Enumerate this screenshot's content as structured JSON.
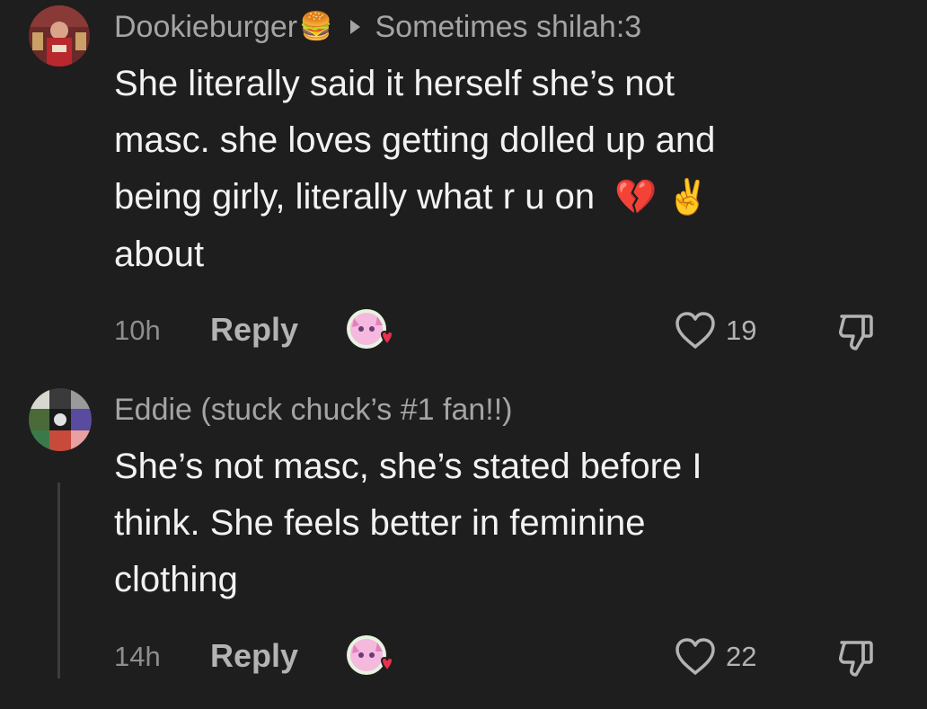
{
  "comment1": {
    "author": "Dookieburger",
    "author_emoji": "🍔",
    "replying_to": "Sometimes shilah:3",
    "text_lines": [
      "She literally said it herself she’s not",
      "masc. she loves getting dolled up and",
      "being girly, literally what r u on",
      "about"
    ],
    "line3_emojis": "💔 ✌️",
    "time": "10h",
    "reply_label": "Reply",
    "likes": "19"
  },
  "comment2": {
    "author": "Eddie (stuck chuck’s #1 fan!!)",
    "text_lines": [
      "She’s not masc, she’s stated before I",
      "think. She feels better in feminine",
      "clothing"
    ],
    "time": "14h",
    "reply_label": "Reply",
    "likes": "22"
  },
  "icons": {
    "like": "heart-outline-icon",
    "dislike": "thumbs-down-icon",
    "creator_liked": "creator-liked-heart-icon",
    "reply_to": "triangle-arrow-icon"
  },
  "colors": {
    "background": "#1e1e1e",
    "author": "#a4a4a4",
    "text": "#f2f2f2",
    "heart_red": "#e8304f"
  }
}
